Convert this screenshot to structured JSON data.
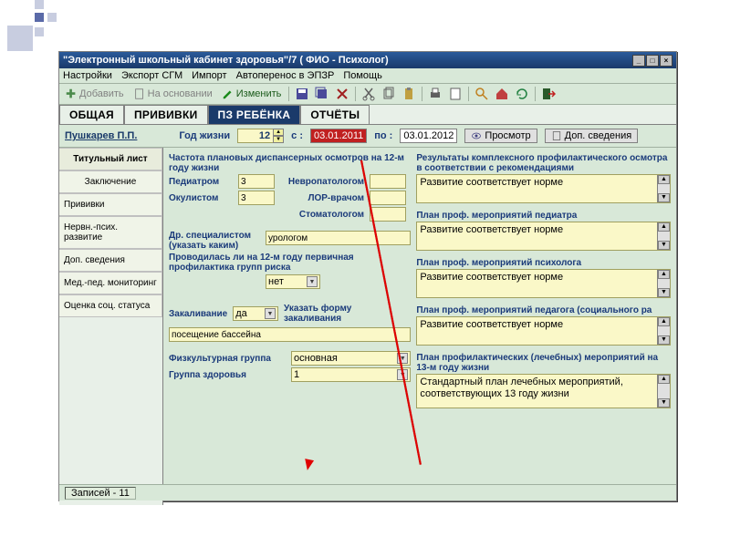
{
  "title": "\"Электронный школьный кабинет здоровья\"/7 ( ФИО - Психолог)",
  "menu": {
    "settings": "Настройки",
    "export": "Экспорт СГМ",
    "import": "Импорт",
    "autotr": "Автоперенос в ЭПЗР",
    "help": "Помощь"
  },
  "toolbar": {
    "add": "Добавить",
    "based": "На основании",
    "edit": "Изменить"
  },
  "tabs": {
    "general": "ОБЩАЯ",
    "priv": "ПРИВИВКИ",
    "pz": "ПЗ РЕБЁНКА",
    "reports": "ОТЧЁТЫ"
  },
  "patient": {
    "name": "Пушкарев П.П.",
    "year_label": "Год жизни",
    "year": "12",
    "from_label": "с :",
    "from": "03.01.2011",
    "to_label": "по :",
    "to": "03.01.2012",
    "view": "Просмотр",
    "extra": "Доп. сведения"
  },
  "sidebar": {
    "title": "Титульный лист",
    "items": [
      {
        "label": "Заключение"
      },
      {
        "label": "Прививки"
      },
      {
        "label": "Нервн.-псих. развитие"
      },
      {
        "label": "Доп. сведения"
      },
      {
        "label": "Мед.-пед. мониторинг"
      },
      {
        "label": "Оценка соц. статуса"
      }
    ]
  },
  "left": {
    "freq_title": "Частота плановых диспансерных осмотров на 12-м году жизни",
    "pediatr": "Педиатром",
    "pediatr_v": "3",
    "okulist": "Окулистом",
    "okulist_v": "3",
    "nevro": "Невропатологом",
    "nevro_v": "",
    "lor": "ЛОР-врачом",
    "lor_v": "",
    "stoma": "Стоматологом",
    "stoma_v": "",
    "drspec": "Др. специалистом (указать каким)",
    "drspec_v": "урологом",
    "prov": "Проводилась ли на 12-м году первичная профилактика групп риска",
    "prov_v": "нет",
    "zakal": "Закаливание",
    "zakal_v": "да",
    "zakal_form": "Указать форму закаливания",
    "zakal_desc": "посещение бассейна",
    "fiz": "Физкультурная группа",
    "fiz_v": "основная",
    "grp": "Группа здоровья",
    "grp_v": "1"
  },
  "right": {
    "res_title": "Результаты комплексного  профилактического осмотра в соответствии с рекомендациями",
    "res_v": "Развитие соответствует норме",
    "plan1": "План проф. мероприятий педиатра",
    "plan1_v": "Развитие  соответствует  норме",
    "plan2": "План проф. мероприятий психолога",
    "plan2_v": "Развитие  соответствует  норме",
    "plan3": "План проф. мероприятий педагога (социального ра",
    "plan3_v": "Развитие соответствует норме",
    "plan4": "План профилактических (лечебных) мероприятий на 13-м году жизни",
    "plan4_v": "Стандартный план лечебных мероприятий, соответствующих 13 году жизни"
  },
  "status": {
    "rec": "Записей - 11"
  }
}
